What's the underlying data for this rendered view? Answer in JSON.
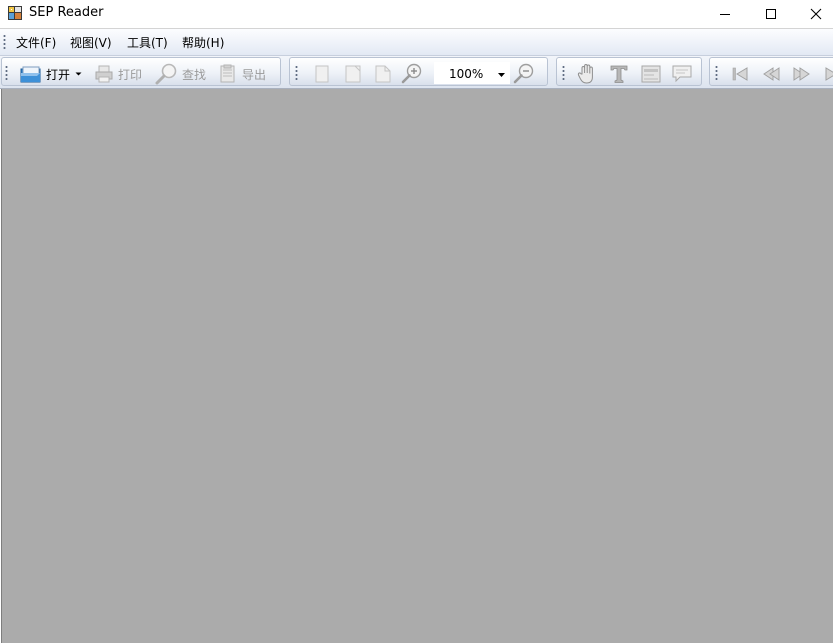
{
  "window": {
    "title": "SEP Reader",
    "icon": "sep-reader-app-icon",
    "controls": [
      "minimize-icon",
      "maximize-icon",
      "close-icon"
    ]
  },
  "menu": {
    "items": [
      {
        "label": "文件(F)"
      },
      {
        "label": "视图(V)"
      },
      {
        "label": "工具(T)"
      },
      {
        "label": "帮助(H)"
      }
    ]
  },
  "toolbar": {
    "file_group": {
      "open": {
        "label": "打开",
        "icon": "open-folder-icon",
        "has_dropdown": true,
        "enabled": true
      },
      "print": {
        "label": "打印",
        "icon": "printer-icon",
        "enabled": false
      },
      "find": {
        "label": "查找",
        "icon": "magnifier-icon",
        "enabled": false
      },
      "export": {
        "label": "导出",
        "icon": "export-document-icon",
        "enabled": false
      }
    },
    "view_group": {
      "buttons": [
        {
          "icon": "single-page-icon",
          "enabled": false
        },
        {
          "icon": "fit-width-page-icon",
          "enabled": false
        },
        {
          "icon": "fit-page-icon",
          "enabled": false
        },
        {
          "icon": "zoom-in-icon",
          "enabled": false
        }
      ],
      "zoom_value": "100%",
      "zoom_out_icon": "zoom-out-icon"
    },
    "tools_group": {
      "buttons": [
        {
          "icon": "hand-tool-icon"
        },
        {
          "icon": "text-select-icon"
        },
        {
          "icon": "snapshot-icon"
        },
        {
          "icon": "comment-icon"
        }
      ]
    },
    "nav_group": {
      "buttons": [
        {
          "icon": "first-page-icon"
        },
        {
          "icon": "previous-page-icon"
        },
        {
          "icon": "next-page-icon"
        },
        {
          "icon": "last-page-icon"
        }
      ]
    }
  },
  "colors": {
    "document_background": "#ababab",
    "disabled_text": "#9a9a9a",
    "menu_gradient_top": "#fcfdff",
    "menu_gradient_bottom": "#e3e9f4"
  }
}
